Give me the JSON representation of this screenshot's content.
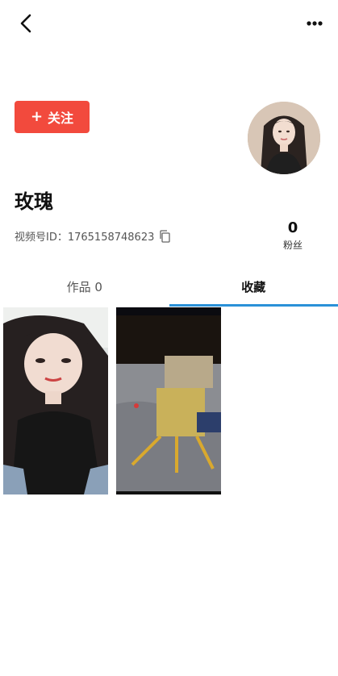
{
  "header": {
    "back_icon": "chevron-left-icon",
    "more_icon": "more-horizontal-icon"
  },
  "profile": {
    "follow_label": "关注",
    "follow_plus": "+",
    "name": "玫瑰",
    "id_text": "视频号ID：1765158748623",
    "fans_count": "0",
    "fans_label": "粉丝"
  },
  "tabs": [
    {
      "label": "作品 0",
      "active": false
    },
    {
      "label": "收藏",
      "active": true
    }
  ],
  "colors": {
    "follow_button": "#f24a3d",
    "tab_indicator": "#2a91d8"
  }
}
